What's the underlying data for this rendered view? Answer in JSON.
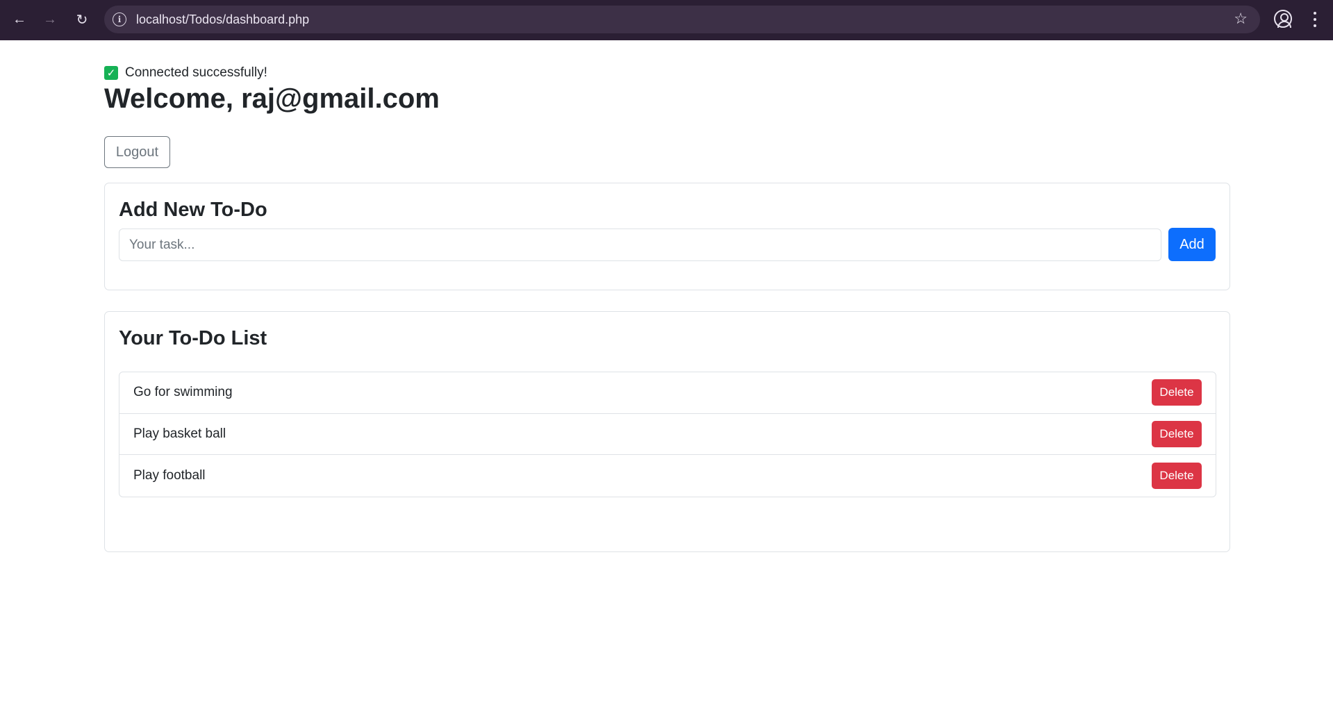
{
  "browser": {
    "url": "localhost/Todos/dashboard.php",
    "icons": {
      "back": "arrow-left-icon",
      "forward": "arrow-right-icon",
      "reload": "reload-icon",
      "site_info": "info-icon",
      "bookmark": "star-icon",
      "profile": "profile-icon",
      "menu": "kebab-menu-icon"
    }
  },
  "status": {
    "icon": "check-icon",
    "text": "Connected successfully!"
  },
  "welcome": "Welcome, raj@gmail.com",
  "logout_label": "Logout",
  "add_card": {
    "title": "Add New To-Do",
    "input_placeholder": "Your task...",
    "input_value": "",
    "add_label": "Add"
  },
  "list_card": {
    "title": "Your To-Do List",
    "items": [
      {
        "text": "Go for swimming",
        "delete_label": "Delete"
      },
      {
        "text": "Play basket ball",
        "delete_label": "Delete"
      },
      {
        "text": "Play football",
        "delete_label": "Delete"
      }
    ]
  },
  "colors": {
    "chrome_bg": "#2b1f34",
    "primary": "#0d6efd",
    "danger": "#dc3545",
    "success": "#16b155",
    "secondary": "#6c757d"
  }
}
